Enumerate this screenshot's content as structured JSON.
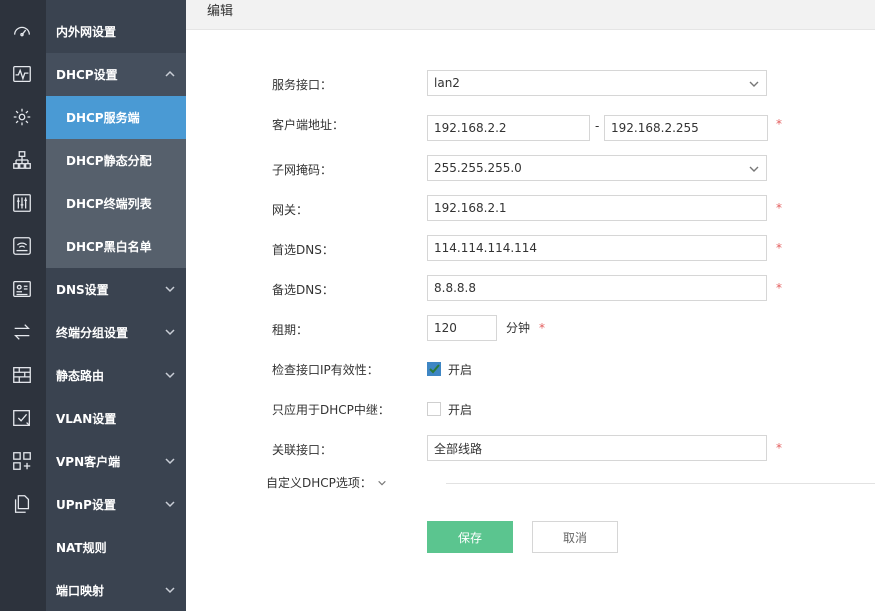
{
  "rail_icons": [
    "speedometer-icon",
    "pulse-chart-icon",
    "gear-icon",
    "network-tree-icon",
    "sliders-icon",
    "router-icon",
    "id-card-icon",
    "transfer-arrows-icon",
    "firewall-grid-icon",
    "checklist-icon",
    "apps-grid-icon",
    "documents-icon"
  ],
  "menu": {
    "items": [
      {
        "label": "内外网设置"
      },
      {
        "label": "DHCP设置"
      },
      {
        "label": "DNS设置"
      },
      {
        "label": "终端分组设置"
      },
      {
        "label": "静态路由"
      },
      {
        "label": "VLAN设置"
      },
      {
        "label": "VPN客户端"
      },
      {
        "label": "UPnP设置"
      },
      {
        "label": "NAT规则"
      },
      {
        "label": "端口映射"
      }
    ],
    "dhcp_sub": [
      {
        "label": "DHCP服务端"
      },
      {
        "label": "DHCP静态分配"
      },
      {
        "label": "DHCP终端列表"
      },
      {
        "label": "DHCP黑白名单"
      }
    ]
  },
  "header": {
    "title": "编辑"
  },
  "form": {
    "service_interface": {
      "label": "服务接口：",
      "value": "lan2"
    },
    "client_address": {
      "label": "客户端地址：",
      "start": "192.168.2.2",
      "sep": "-",
      "end": "192.168.2.255"
    },
    "subnet_mask": {
      "label": "子网掩码：",
      "value": "255.255.255.0"
    },
    "gateway": {
      "label": "网关：",
      "value": "192.168.2.1"
    },
    "primary_dns": {
      "label": "首选DNS：",
      "value": "114.114.114.114"
    },
    "secondary_dns": {
      "label": "备选DNS：",
      "value": "8.8.8.8"
    },
    "lease": {
      "label": "租期：",
      "value": "120",
      "unit": "分钟"
    },
    "check_ip": {
      "label": "检查接口IP有效性：",
      "checked": true,
      "option": "开启"
    },
    "relay_only": {
      "label": "只应用于DHCP中继：",
      "checked": false,
      "option": "开启"
    },
    "linked_interface": {
      "label": "关联接口：",
      "value": "全部线路"
    },
    "required_mark": "*",
    "advanced": {
      "label": "自定义DHCP选项："
    }
  },
  "buttons": {
    "save": "保存",
    "cancel": "取消"
  },
  "colors": {
    "rail": "#2d333d",
    "menu": "#3a4350",
    "active": "#4a9ad4",
    "save": "#5bc58f",
    "required": "#e35d5d"
  }
}
